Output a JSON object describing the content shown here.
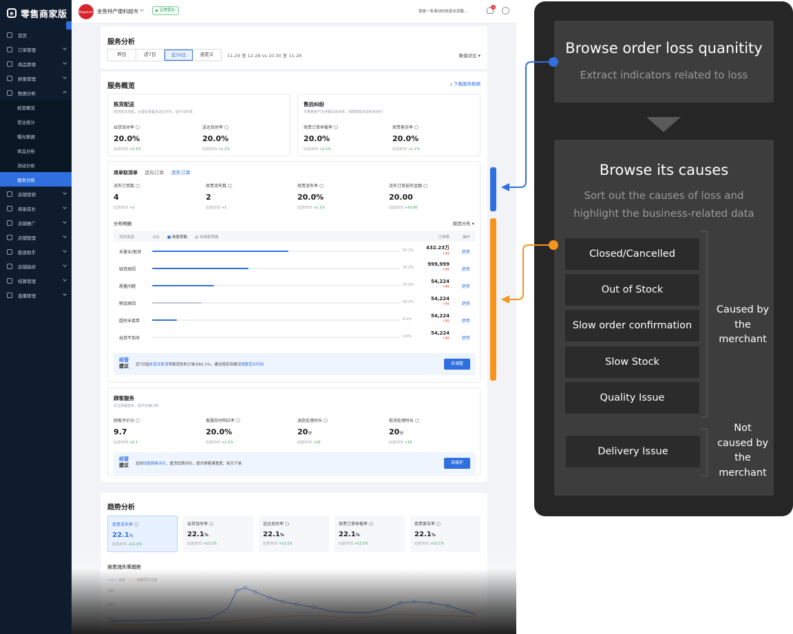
{
  "sidebar": {
    "brand": "零售商家版",
    "items": [
      {
        "label": "首页",
        "chev": false
      },
      {
        "label": "订单管理",
        "chev": true
      },
      {
        "label": "商品管理",
        "chev": true
      },
      {
        "label": "顾客管理",
        "chev": true
      },
      {
        "label": "数据分析",
        "chev": true,
        "open": true
      }
    ],
    "sub_items": [
      "经营概览",
      "营业统计",
      "曝光数据",
      "商品分析",
      "流动分析",
      "服务分析"
    ],
    "items_after": [
      "店铺营销",
      "商家成长",
      "店铺推广",
      "店铺管理",
      "配送助手",
      "店铺装修",
      "结算管理",
      "直播管理"
    ]
  },
  "topbar": {
    "store_logo": "Megamart",
    "store_name": "金鱼特产便利超市",
    "status": "正常营业",
    "marquee": "我是一条滚动的信息出货截...",
    "badge": "5"
  },
  "service": {
    "title": "服务分析",
    "ranges": [
      "昨日",
      "近7日",
      "近30日",
      "自定义"
    ],
    "range_active": 2,
    "date_range": "11-29 至 12-28   vs   10-30 至 11-28",
    "compare": "数值对比"
  },
  "overview": {
    "title": "服务概览",
    "download": "下载服务数据",
    "picking": {
      "title": "拣货配送",
      "desc": "规范拣货流程，合理设置备货送达时长，提升及时率",
      "m1": {
        "label": "出货及时率",
        "value": "20.0%",
        "cmp": "比前30日",
        "delta": "+2.1%"
      },
      "m2": {
        "label": "送达及时率",
        "value": "20.0%",
        "cmp": "比前30日",
        "delta": "+1.1%"
      }
    },
    "after": {
      "title": "售后纠纷",
      "desc": "尽量避免产生仲裁及客诉率，保障顾客体验和信用分",
      "m1": {
        "label": "商责订单仲裁率",
        "value": "20.0%",
        "cmp": "比前30日",
        "delta": "+1.1%"
      },
      "m2": {
        "label": "商责客诉率",
        "value": "20.0%",
        "cmp": "比前30日",
        "delta": "+1.1%"
      }
    }
  },
  "cancel": {
    "tab1": "退单取消单",
    "tab2": "逆向订单",
    "tab3": "流失订单",
    "m1": {
      "label": "流失订单数",
      "value": "4",
      "cmp": "比前30日",
      "delta": "+2"
    },
    "m2": {
      "label": "商责流失数",
      "value": "2",
      "cmp": "比前30日",
      "delta": "+1"
    },
    "m3": {
      "label": "商责流失率",
      "value": "20.0%",
      "cmp": "比前30日",
      "delta": "+1.1%"
    },
    "m4": {
      "label": "流失订单损失金额",
      "value": "20.00",
      "cmp": "比前30日",
      "delta": "+10.00"
    },
    "dist_title": "分布明细",
    "dist_dd": "原因分布",
    "head": {
      "reason": "流失原因",
      "share": "占比",
      "merchant": "商家导致",
      "nonmerchant": "非商家导致",
      "count": "订单数",
      "op": "操作"
    },
    "rows": [
      {
        "name": "未营业/取消",
        "pct": "50.2%",
        "fill": 0.55,
        "color": "#2f6fe0",
        "count": "432.23万",
        "delta": "↑45",
        "act": "趋势"
      },
      {
        "name": "缺货原因",
        "pct": "30.2%",
        "fill": 0.39,
        "color": "#2f6fe0",
        "count": "999,999",
        "delta": "↑45",
        "act": "趋势"
      },
      {
        "name": "质量问题",
        "pct": "20.2%",
        "fill": 0.25,
        "color": "#2f6fe0",
        "count": "54,224",
        "delta": "↑45",
        "act": "趋势"
      },
      {
        "name": "物流原因",
        "pct": "16.2%",
        "fill": 0.2,
        "color": "#bfc4cc",
        "count": "54,224",
        "delta": "↑45",
        "act": "趋势"
      },
      {
        "name": "超时未接单",
        "pct": "8.2%",
        "fill": 0.1,
        "color": "#2f6fe0",
        "count": "54,224",
        "delta": "↑45",
        "act": "趋势"
      },
      {
        "name": "出货不及时",
        "pct": "0.0%",
        "fill": 0,
        "color": "#2f6fe0",
        "count": "54,224",
        "delta": "↑45",
        "act": "趋势"
      }
    ],
    "tip": {
      "tag1": "经营",
      "tag2": "建议",
      "pre": "近7日因",
      "link1": "未营业取消",
      "mid": "导致流失的订单占82.1%，建议按实际情况",
      "link2": "调整营业时间",
      "btn": "去调整"
    }
  },
  "customer": {
    "title": "顾客服务",
    "desc": "关注顾客服务，提升店铺口碑",
    "m1": {
      "label": "顾客评价分",
      "value": "9.7",
      "unit": "",
      "cmp": "比前30日",
      "delta": "+0.1"
    },
    "m2": {
      "label": "客服及时响应率",
      "value": "20.0%",
      "unit": "",
      "cmp": "比前30日",
      "delta": "+1.1%"
    },
    "m3": {
      "label": "退款处理时长",
      "value": "20",
      "unit": "分",
      "cmp": "比前30日",
      "delta": "+10"
    },
    "m4": {
      "label": "取消处理时长",
      "value": "20",
      "unit": "分",
      "cmp": "比前30日",
      "delta": "+10"
    },
    "tip": {
      "tag1": "经营",
      "tag2": "建议",
      "pre": "及时",
      "link": "回复顾客评价",
      "post": "，置顶优质评价，提升顾客满意度，吸引下单",
      "btn": "去维护"
    }
  },
  "trend": {
    "title": "趋势分析",
    "kpis": [
      {
        "label": "商责流失率",
        "value": "22.1",
        "unit": "%",
        "cmp": "比前30日",
        "delta": "+12.1%",
        "on": true
      },
      {
        "label": "出货及时率",
        "value": "22.1",
        "unit": "%",
        "cmp": "比前30日",
        "delta": "+12.1%",
        "on": false
      },
      {
        "label": "送达及时率",
        "value": "22.1",
        "unit": "%",
        "cmp": "比前30日",
        "delta": "+12.1%",
        "on": false
      },
      {
        "label": "商责订单仲裁率",
        "value": "22.1",
        "unit": "%",
        "cmp": "比前30日",
        "delta": "+12.1%",
        "on": false
      },
      {
        "label": "商责客诉率",
        "value": "22.1",
        "unit": "%",
        "cmp": "比前30日",
        "delta": "+12.1%",
        "on": false
      }
    ],
    "chart_title": "商责流失率趋势",
    "legend1": "本店",
    "legend2": "商圈同行均值",
    "y_ticks": [
      "400",
      "800",
      "400"
    ]
  },
  "annotation": {
    "step1_title": "Browse order loss quanitity",
    "step1_sub": "Extract indicators related to loss",
    "step2_title": "Browse its causes",
    "step2_sub": "Sort out the causes of loss and highlight the business-related data",
    "causes": [
      "Closed/Cancelled",
      "Out of Stock",
      "Slow order confirmation",
      "Slow Stock",
      "Quality Issue"
    ],
    "other_cause": "Delivery Issue",
    "caused_label": "Caused by the merchant",
    "not_caused_label": "Not caused by the merchant",
    "colors": {
      "blue": "#2f6fe0",
      "orange": "#f7941d"
    }
  }
}
